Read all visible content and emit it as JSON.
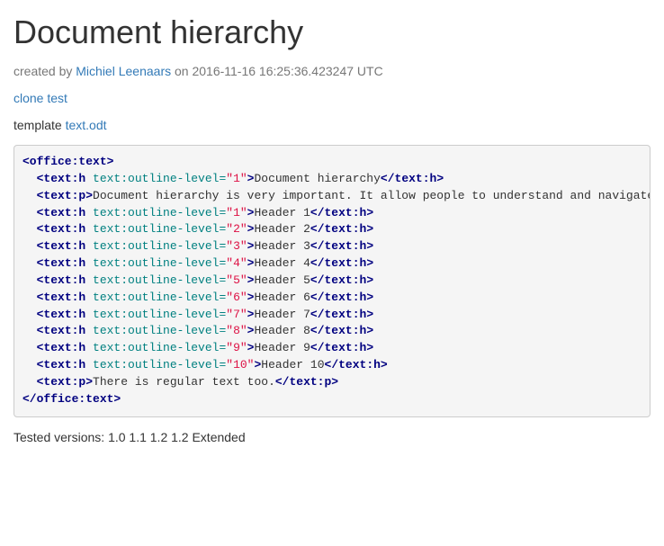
{
  "title": "Document hierarchy",
  "meta": {
    "created_by_prefix": "created by ",
    "author": "Michiel Leenaars",
    "on": " on 2016-11-16 16:25:36.423247 UTC"
  },
  "clone_link": "clone test",
  "template_label": "template ",
  "template_file": "text.odt",
  "xml": {
    "root_open": "<office:text>",
    "root_close": "</office:text>",
    "h_open": "<text:h",
    "h_close": "</text:h>",
    "p_open": "<text:p>",
    "p_close": "</text:p>",
    "attr_name": "text:outline-level",
    "gt": ">",
    "doc_title": "Document hierarchy",
    "para1": "Document hierarchy is very important. It allow people to understand and navigate the document efficiently. A uniform heading structure is often the most important accessibility consideration in documents. When encountering a lengthy text document, sighted users often scroll the page quickly and get an idea of its structure and content. Screen reader and other assistive technology users also can navigate documents by heading structure.",
    "headers": [
      {
        "level": "1",
        "text": "Header 1"
      },
      {
        "level": "2",
        "text": "Header 2"
      },
      {
        "level": "3",
        "text": "Header 3"
      },
      {
        "level": "4",
        "text": "Header 4"
      },
      {
        "level": "5",
        "text": "Header 5"
      },
      {
        "level": "6",
        "text": "Header 6"
      },
      {
        "level": "7",
        "text": "Header 7"
      },
      {
        "level": "8",
        "text": "Header 8"
      },
      {
        "level": "9",
        "text": "Header 9"
      },
      {
        "level": "10",
        "text": "Header 10"
      }
    ],
    "para2": "There is regular text too."
  },
  "tested_prefix": "Tested versions: ",
  "tested_versions": "1.0 1.1 1.2 1.2 Extended"
}
